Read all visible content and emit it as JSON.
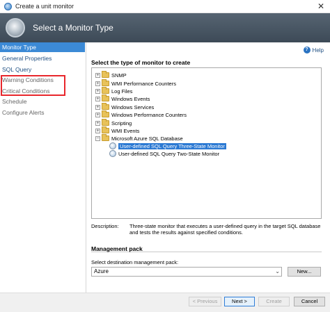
{
  "window": {
    "title": "Create a unit monitor",
    "close_glyph": "✕"
  },
  "header": {
    "title": "Select a Monitor Type"
  },
  "nav": {
    "items": [
      {
        "label": "Monitor Type"
      },
      {
        "label": "General Properties"
      },
      {
        "label": "SQL Query"
      },
      {
        "label": "Warning Conditions"
      },
      {
        "label": "Critical Conditions"
      },
      {
        "label": "Schedule"
      },
      {
        "label": "Configure Alerts"
      }
    ]
  },
  "help": {
    "label": "Help"
  },
  "main": {
    "section_title": "Select the type of monitor to create",
    "tree": [
      {
        "label": "SNMP"
      },
      {
        "label": "WMI Performance Counters"
      },
      {
        "label": "Log Files"
      },
      {
        "label": "Windows Events"
      },
      {
        "label": "Windows Services"
      },
      {
        "label": "Windows Performance Counters"
      },
      {
        "label": "Scripting"
      },
      {
        "label": "WMI Events"
      },
      {
        "label": "Microsoft Azure SQL Database"
      },
      {
        "label": "User-defined SQL Query Three-State Monitor"
      },
      {
        "label": "User-defined SQL Query Two-State Monitor"
      }
    ],
    "description_label": "Description:",
    "description_text": "Three-state monitor that executes a user-defined query in the target SQL database and tests the results against specified conditions."
  },
  "management_pack": {
    "title": "Management pack",
    "select_label": "Select destination management pack:",
    "selected_value": "Azure",
    "new_button": "New..."
  },
  "footer": {
    "previous": "< Previous",
    "next": "Next >",
    "create": "Create",
    "cancel": "Cancel"
  }
}
